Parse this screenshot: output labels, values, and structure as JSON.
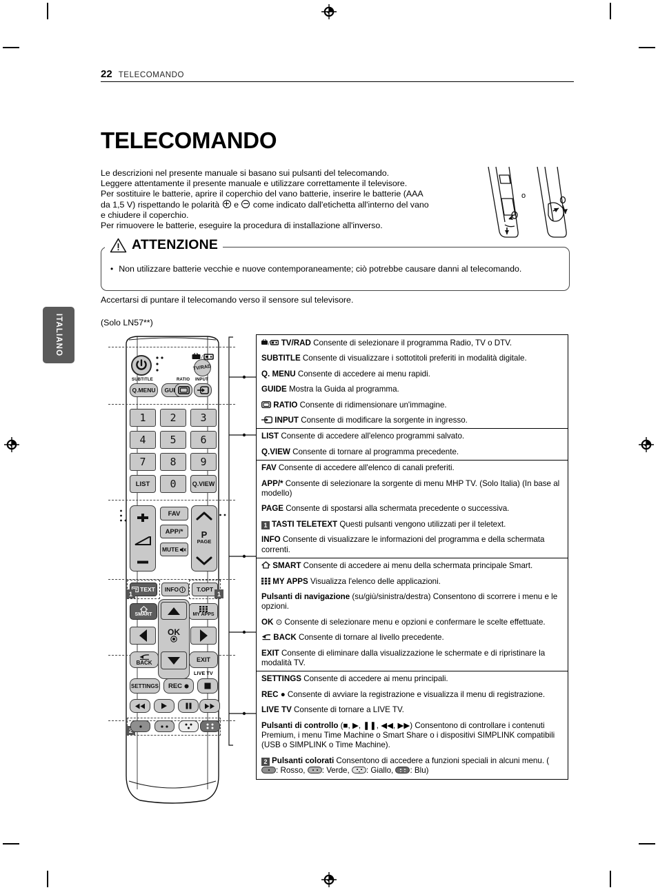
{
  "header": {
    "page_number": "22",
    "section": "TELECOMANDO"
  },
  "title": "TELECOMANDO",
  "intro": {
    "line1": "Le descrizioni nel presente manuale si basano sui pulsanti del telecomando.",
    "line2": "Leggere attentamente il presente manuale e utilizzare correttamente il televisore.",
    "line3": "Per sostituire le batterie, aprire il coperchio del vano batterie, inserire le batterie (AAA",
    "line4a": "da 1,5 V) rispettando le polarità ",
    "line4b": " e ",
    "line4c": " come indicato dall'etichetta all'interno del vano",
    "line5": "e chiudere il coperchio.",
    "line6": "Per rimuovere le batterie, eseguire la procedura di installazione all'inverso."
  },
  "battery_art": {
    "or_label": "o"
  },
  "caution": {
    "label": "ATTENZIONE",
    "bullet_marker": "•",
    "text": "Non utilizzare batterie vecchie e nuove contemporaneamente; ciò potrebbe causare danni al telecomando."
  },
  "after_caution": "Accertarsi di puntare il telecomando verso il sensore sul televisore.",
  "model_note": "(Solo LN57**)",
  "language_tab": "ITALIANO",
  "remote": {
    "buttons": {
      "power": "power-icon",
      "subtitle_label": "SUBTITLE",
      "q_menu": "Q.MENU",
      "guide": "GUIDE",
      "ratio_label": "RATIO",
      "input_label": "INPUT",
      "tv_rad": "TV/RAD",
      "num1": "1",
      "num2": "2",
      "num3": "3",
      "num4": "4",
      "num5": "5",
      "num6": "6",
      "num7": "7",
      "num8": "8",
      "num9": "9",
      "num0": "0",
      "list": "LIST",
      "qview": "Q.VIEW",
      "fav": "FAV",
      "app": "APP/*",
      "mute": "MUTE",
      "page_p": "P",
      "page_label": "PAGE",
      "text": "TEXT",
      "info": "INFO",
      "topt": "T.OPT",
      "smart": "SMART",
      "myapps": "MY APPS",
      "ok": "OK",
      "back": "BACK",
      "exit": "EXIT",
      "live_tv": "LIVE TV",
      "settings": "SETTINGS",
      "rec": "REC",
      "badge1": "1",
      "badge2": "2"
    }
  },
  "table": {
    "groups": [
      {
        "rows": [
          {
            "icon": "tv-radio-icon",
            "bold": "TV/RAD",
            "text": " Consente di selezionare il programma Radio, TV o DTV."
          },
          {
            "icon": "",
            "bold": "SUBTITLE",
            "text": " Consente di visualizzare i sottotitoli preferiti in modalità digitale."
          },
          {
            "icon": "",
            "bold": "Q. MENU",
            "text": " Consente di accedere ai menu rapidi."
          },
          {
            "icon": "",
            "bold": "GUIDE",
            "text": " Mostra la Guida al programma."
          },
          {
            "icon": "ratio-icon",
            "bold": "RATIO",
            "text": " Consente di ridimensionare un'immagine."
          },
          {
            "icon": "input-icon",
            "bold": "INPUT",
            "text": " Consente di modificare la sorgente in ingresso."
          }
        ]
      },
      {
        "rows": [
          {
            "icon": "",
            "bold": "LIST",
            "text": " Consente di accedere all'elenco programmi salvato."
          },
          {
            "icon": "",
            "bold": "Q.VIEW",
            "text": " Consente di tornare al programma precedente."
          }
        ]
      },
      {
        "rows": [
          {
            "icon": "",
            "bold": "FAV",
            "text": " Consente di accedere all'elenco di canali preferiti."
          },
          {
            "icon": "",
            "bold": "APP/*",
            "text": " Consente di selezionare la sorgente di menu MHP TV. (Solo Italia) (In base al modello)"
          },
          {
            "icon": "",
            "bold": "PAGE",
            "text": " Consente di spostarsi alla schermata precedente o successiva."
          },
          {
            "icon": "badge-1",
            "bold": "TASTI TELETEXT",
            "text": " Questi pulsanti vengono utilizzati per il teletext."
          },
          {
            "icon": "",
            "bold": "INFO",
            "text": " Consente di visualizzare le informazioni del programma e della schermata correnti."
          }
        ]
      },
      {
        "rows": [
          {
            "icon": "home-icon",
            "bold": "SMART",
            "text": " Consente di accedere ai menu della schermata principale Smart."
          },
          {
            "icon": "grid-icon",
            "bold": "MY APPS",
            "text": " Visualizza l'elenco delle applicazioni."
          },
          {
            "icon": "",
            "bold": "Pulsanti di navigazione",
            "text": " (su/giù/sinistra/destra) Consentono di scorrere i menu e le opzioni."
          },
          {
            "icon": "",
            "bold": "OK",
            "text": " ⊙ Consente di selezionare menu e opzioni e confermare le scelte effettuate."
          },
          {
            "icon": "back-arrow-icon",
            "bold": "BACK",
            "text": " Consente di tornare al livello precedente."
          },
          {
            "icon": "",
            "bold": "EXIT",
            "text": " Consente di eliminare dalla visualizzazione le schermate e di ripristinare la modalità TV."
          }
        ]
      },
      {
        "rows": [
          {
            "icon": "",
            "bold": "SETTINGS",
            "text": " Consente di accedere ai menu principali."
          },
          {
            "icon": "",
            "bold": "REC",
            "text": " ● Consente di avviare la registrazione e visualizza il menu di registrazione."
          },
          {
            "icon": "",
            "bold": "LIVE TV",
            "text": " Consente di tornare a LIVE TV."
          },
          {
            "icon": "",
            "bold": "Pulsanti di controllo",
            "text": " (■, ▶, ❚❚, ◀◀, ▶▶) Consentono di controllare i contenuti Premium, i menu Time Machine o Smart Share o i dispositivi SIMPLINK compatibili (USB o SIMPLINK o Time Machine)."
          },
          {
            "icon": "badge-2",
            "bold": "Pulsanti colorati",
            "text": " Consentono di accedere a funzioni speciali in alcuni menu. (",
            "colors": {
              "red": ": Rosso, ",
              "green": ": Verde, ",
              "yellow": ": Giallo, ",
              "blue": ": Blu)"
            }
          }
        ]
      }
    ]
  }
}
